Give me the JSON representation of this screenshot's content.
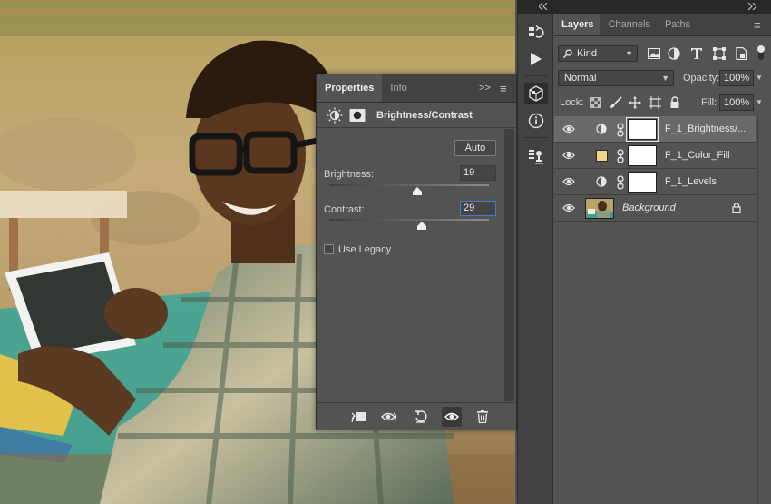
{
  "properties": {
    "tabs": [
      "Properties",
      "Info"
    ],
    "collapse_glyph": ">>",
    "menu_glyph": "≡",
    "header_title": "Brightness/Contrast",
    "auto_label": "Auto",
    "brightness_label": "Brightness:",
    "brightness_value": "19",
    "brightness_level": 0.55,
    "contrast_label": "Contrast:",
    "contrast_value": "29",
    "contrast_level": 0.58,
    "use_legacy_label": "Use Legacy",
    "use_legacy_checked": false
  },
  "dock": {
    "icons": [
      "history-icon",
      "actions-play-icon",
      "3d-icon",
      "info-icon",
      "clone-source-icon"
    ]
  },
  "layers": {
    "tabs": [
      "Layers",
      "Channels",
      "Paths"
    ],
    "filter_kind_label": "Kind",
    "blend_mode": "Normal",
    "opacity_label": "Opacity:",
    "opacity_value": "100%",
    "lock_label": "Lock:",
    "fill_label": "Fill:",
    "fill_value": "100%",
    "items": [
      {
        "name": "F_1_Brightness/...",
        "type": "adjustment",
        "selected": true
      },
      {
        "name": "F_1_Color_Fill",
        "type": "fill",
        "fill_color": "#f0d58b",
        "selected": false
      },
      {
        "name": "F_1_Levels",
        "type": "adjustment",
        "selected": false
      },
      {
        "name": "Background",
        "type": "background",
        "locked": true,
        "selected": false
      }
    ]
  },
  "colors": {
    "panel": "#535353",
    "panel_dark": "#424242",
    "selected_row": "#696969",
    "focus_border": "#3b7ed6",
    "color_fill_swatch": "#f0d58b"
  }
}
